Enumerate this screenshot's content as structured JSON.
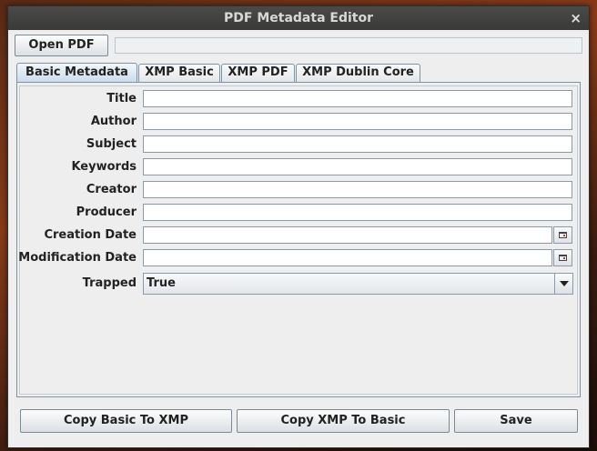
{
  "window": {
    "title": "PDF Metadata Editor",
    "close_glyph": "×"
  },
  "toolbar": {
    "open_pdf_label": "Open PDF",
    "path_value": ""
  },
  "tabs": [
    {
      "label": "Basic Metadata",
      "active": true
    },
    {
      "label": "XMP Basic",
      "active": false
    },
    {
      "label": "XMP PDF",
      "active": false
    },
    {
      "label": "XMP Dublin Core",
      "active": false
    }
  ],
  "fields": {
    "title": {
      "label": "Title",
      "value": ""
    },
    "author": {
      "label": "Author",
      "value": ""
    },
    "subject": {
      "label": "Subject",
      "value": ""
    },
    "keywords": {
      "label": "Keywords",
      "value": ""
    },
    "creator": {
      "label": "Creator",
      "value": ""
    },
    "producer": {
      "label": "Producer",
      "value": ""
    },
    "creation_date": {
      "label": "Creation Date",
      "value": ""
    },
    "modification_date": {
      "label": "Modification Date",
      "value": ""
    },
    "trapped": {
      "label": "Trapped",
      "value": "True"
    }
  },
  "actions": {
    "copy_basic_to_xmp": "Copy Basic To XMP",
    "copy_xmp_to_basic": "Copy XMP To Basic",
    "save": "Save"
  },
  "icons": {
    "calendar": "calendar-icon",
    "dropdown": "chevron-down-icon",
    "close": "close-icon"
  }
}
